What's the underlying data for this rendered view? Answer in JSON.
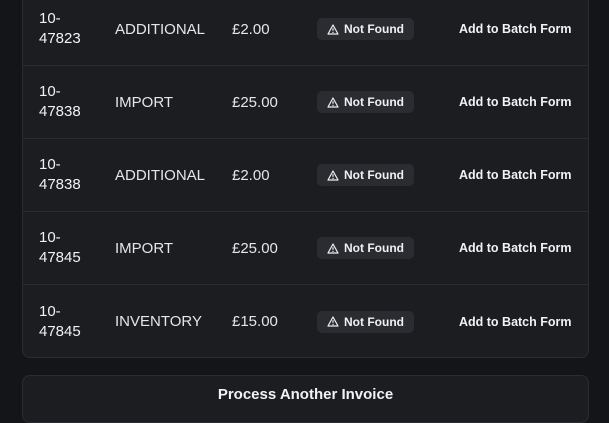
{
  "rows": [
    {
      "ref": "10-\n47823",
      "type": "ADDITIONAL",
      "amount": "£2.00",
      "status": "Not Found",
      "action": "Add to Batch Form"
    },
    {
      "ref": "10-\n47838",
      "type": "IMPORT",
      "amount": "£25.00",
      "status": "Not Found",
      "action": "Add to Batch Form"
    },
    {
      "ref": "10-\n47838",
      "type": "ADDITIONAL",
      "amount": "£2.00",
      "status": "Not Found",
      "action": "Add to Batch Form"
    },
    {
      "ref": "10-\n47845",
      "type": "IMPORT",
      "amount": "£25.00",
      "status": "Not Found",
      "action": "Add to Batch Form"
    },
    {
      "ref": "10-\n47845",
      "type": "INVENTORY",
      "amount": "£15.00",
      "status": "Not Found",
      "action": "Add to Batch Form"
    }
  ],
  "status_icon": "warning-triangle-icon",
  "footer": {
    "process_another_label": "Process Another Invoice"
  },
  "colors": {
    "background": "#141518",
    "card": "#1c1d21",
    "border": "#2b2c31",
    "badge": "#2a2c31",
    "text": "#f2f2f4"
  }
}
